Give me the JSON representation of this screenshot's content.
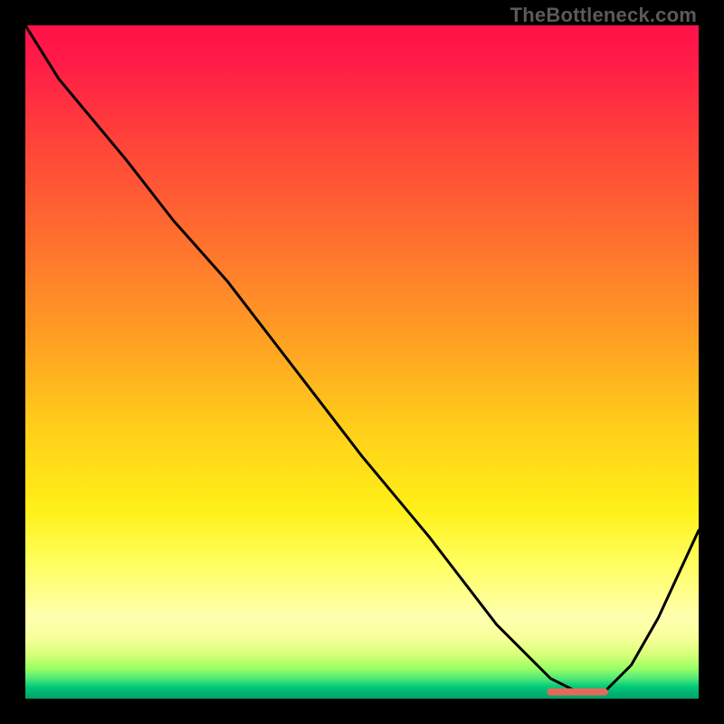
{
  "watermark": "TheBottleneck.com",
  "colors": {
    "curve": "#000000",
    "marker": "#e36a5a"
  },
  "chart_data": {
    "type": "line",
    "title": "",
    "xlabel": "",
    "ylabel": "",
    "xlim": [
      0,
      100
    ],
    "ylim": [
      0,
      100
    ],
    "grid": false,
    "series": [
      {
        "name": "curve",
        "x": [
          0,
          5,
          15,
          22,
          30,
          40,
          50,
          60,
          70,
          78,
          82,
          86,
          90,
          94,
          100
        ],
        "y": [
          100,
          92,
          80,
          71,
          62,
          49,
          36,
          24,
          11,
          3,
          1,
          1,
          5,
          12,
          25
        ]
      }
    ],
    "marker": {
      "name": "optimal-range",
      "x_range": [
        78,
        86
      ],
      "y": 1
    }
  }
}
